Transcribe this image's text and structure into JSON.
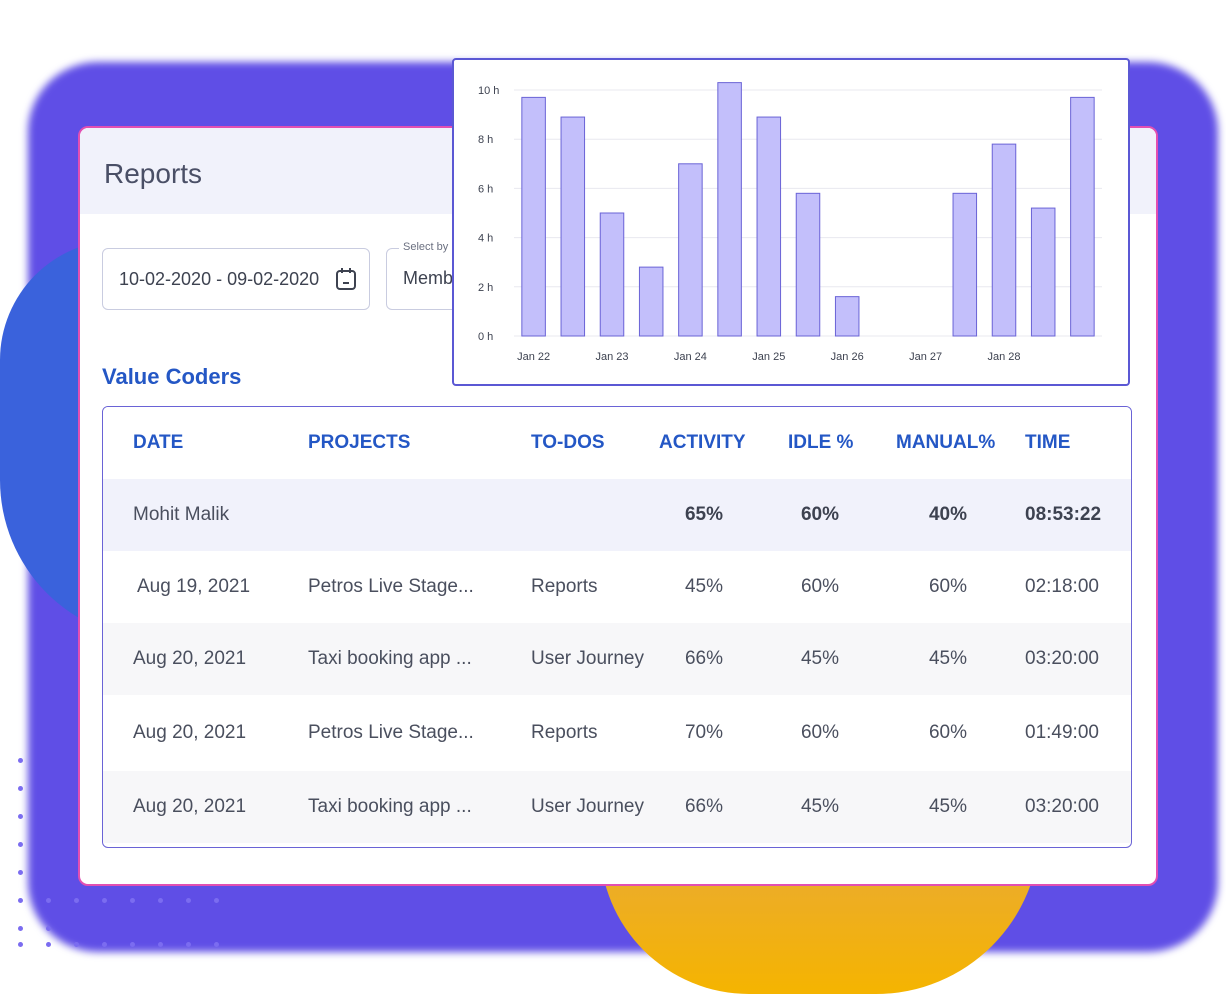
{
  "app": {
    "title": "Reports"
  },
  "filters": {
    "date_range": "10-02-2020 - 09-02-2020",
    "select_label": "Select by",
    "select_value": "Members"
  },
  "section": {
    "title": "Value Coders"
  },
  "table": {
    "headers": [
      "DATE",
      "PROJECTS",
      "TO-DOS",
      "ACTIVITY",
      "IDLE %",
      "MANUAL%",
      "TIME"
    ],
    "group": {
      "name": "Mohit Malik",
      "activity": "65%",
      "idle": "60%",
      "manual": "40%",
      "time": "08:53:22"
    },
    "rows": [
      {
        "date": "Aug 19, 2021",
        "project": "Petros Live Stage...",
        "todo": "Reports",
        "activity": "45%",
        "idle": "60%",
        "manual": "60%",
        "time": "02:18:00"
      },
      {
        "date": "Aug 20, 2021",
        "project": "Taxi booking app ...",
        "todo": "User Journey",
        "activity": "66%",
        "idle": "45%",
        "manual": "45%",
        "time": "03:20:00"
      },
      {
        "date": "Aug 20, 2021",
        "project": "Petros Live Stage...",
        "todo": "Reports",
        "activity": "70%",
        "idle": "60%",
        "manual": "60%",
        "time": "01:49:00"
      },
      {
        "date": "Aug 20, 2021",
        "project": "Taxi booking app ...",
        "todo": "User Journey",
        "activity": "66%",
        "idle": "45%",
        "manual": "45%",
        "time": "03:20:00"
      }
    ]
  },
  "colors": {
    "accent": "#2457c5",
    "bar_fill": "#c3bffb",
    "bar_stroke": "#6a63d6",
    "card_border": "#e24fb2"
  },
  "icons": {
    "calendar": "calendar-icon"
  },
  "chart_data": {
    "type": "bar",
    "title": "",
    "xlabel": "",
    "ylabel": "",
    "ylim": [
      0,
      10
    ],
    "y_ticks": [
      "0 h",
      "2 h",
      "4 h",
      "6 h",
      "8 h",
      "10 h"
    ],
    "x_tick_labels": [
      "Jan 22",
      "Jan 23",
      "Jan 24",
      "Jan 25",
      "Jan 26",
      "Jan 27",
      "Jan 28"
    ],
    "values": [
      9.7,
      8.9,
      5.0,
      2.8,
      7.0,
      10.3,
      8.9,
      5.8,
      1.6,
      0,
      0,
      5.8,
      7.8,
      5.2,
      9.7
    ],
    "grid": true
  }
}
